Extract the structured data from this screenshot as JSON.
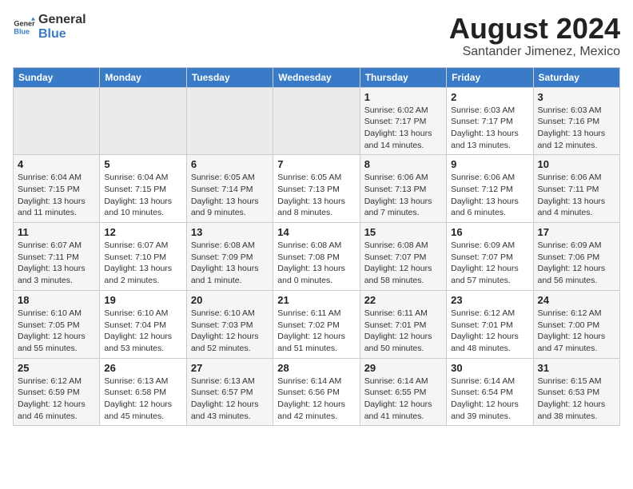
{
  "header": {
    "logo_line1": "General",
    "logo_line2": "Blue",
    "main_title": "August 2024",
    "subtitle": "Santander Jimenez, Mexico"
  },
  "calendar": {
    "days_of_week": [
      "Sunday",
      "Monday",
      "Tuesday",
      "Wednesday",
      "Thursday",
      "Friday",
      "Saturday"
    ],
    "weeks": [
      [
        {
          "day": "",
          "info": ""
        },
        {
          "day": "",
          "info": ""
        },
        {
          "day": "",
          "info": ""
        },
        {
          "day": "",
          "info": ""
        },
        {
          "day": "1",
          "info": "Sunrise: 6:02 AM\nSunset: 7:17 PM\nDaylight: 13 hours\nand 14 minutes."
        },
        {
          "day": "2",
          "info": "Sunrise: 6:03 AM\nSunset: 7:17 PM\nDaylight: 13 hours\nand 13 minutes."
        },
        {
          "day": "3",
          "info": "Sunrise: 6:03 AM\nSunset: 7:16 PM\nDaylight: 13 hours\nand 12 minutes."
        }
      ],
      [
        {
          "day": "4",
          "info": "Sunrise: 6:04 AM\nSunset: 7:15 PM\nDaylight: 13 hours\nand 11 minutes."
        },
        {
          "day": "5",
          "info": "Sunrise: 6:04 AM\nSunset: 7:15 PM\nDaylight: 13 hours\nand 10 minutes."
        },
        {
          "day": "6",
          "info": "Sunrise: 6:05 AM\nSunset: 7:14 PM\nDaylight: 13 hours\nand 9 minutes."
        },
        {
          "day": "7",
          "info": "Sunrise: 6:05 AM\nSunset: 7:13 PM\nDaylight: 13 hours\nand 8 minutes."
        },
        {
          "day": "8",
          "info": "Sunrise: 6:06 AM\nSunset: 7:13 PM\nDaylight: 13 hours\nand 7 minutes."
        },
        {
          "day": "9",
          "info": "Sunrise: 6:06 AM\nSunset: 7:12 PM\nDaylight: 13 hours\nand 6 minutes."
        },
        {
          "day": "10",
          "info": "Sunrise: 6:06 AM\nSunset: 7:11 PM\nDaylight: 13 hours\nand 4 minutes."
        }
      ],
      [
        {
          "day": "11",
          "info": "Sunrise: 6:07 AM\nSunset: 7:11 PM\nDaylight: 13 hours\nand 3 minutes."
        },
        {
          "day": "12",
          "info": "Sunrise: 6:07 AM\nSunset: 7:10 PM\nDaylight: 13 hours\nand 2 minutes."
        },
        {
          "day": "13",
          "info": "Sunrise: 6:08 AM\nSunset: 7:09 PM\nDaylight: 13 hours\nand 1 minute."
        },
        {
          "day": "14",
          "info": "Sunrise: 6:08 AM\nSunset: 7:08 PM\nDaylight: 13 hours\nand 0 minutes."
        },
        {
          "day": "15",
          "info": "Sunrise: 6:08 AM\nSunset: 7:07 PM\nDaylight: 12 hours\nand 58 minutes."
        },
        {
          "day": "16",
          "info": "Sunrise: 6:09 AM\nSunset: 7:07 PM\nDaylight: 12 hours\nand 57 minutes."
        },
        {
          "day": "17",
          "info": "Sunrise: 6:09 AM\nSunset: 7:06 PM\nDaylight: 12 hours\nand 56 minutes."
        }
      ],
      [
        {
          "day": "18",
          "info": "Sunrise: 6:10 AM\nSunset: 7:05 PM\nDaylight: 12 hours\nand 55 minutes."
        },
        {
          "day": "19",
          "info": "Sunrise: 6:10 AM\nSunset: 7:04 PM\nDaylight: 12 hours\nand 53 minutes."
        },
        {
          "day": "20",
          "info": "Sunrise: 6:10 AM\nSunset: 7:03 PM\nDaylight: 12 hours\nand 52 minutes."
        },
        {
          "day": "21",
          "info": "Sunrise: 6:11 AM\nSunset: 7:02 PM\nDaylight: 12 hours\nand 51 minutes."
        },
        {
          "day": "22",
          "info": "Sunrise: 6:11 AM\nSunset: 7:01 PM\nDaylight: 12 hours\nand 50 minutes."
        },
        {
          "day": "23",
          "info": "Sunrise: 6:12 AM\nSunset: 7:01 PM\nDaylight: 12 hours\nand 48 minutes."
        },
        {
          "day": "24",
          "info": "Sunrise: 6:12 AM\nSunset: 7:00 PM\nDaylight: 12 hours\nand 47 minutes."
        }
      ],
      [
        {
          "day": "25",
          "info": "Sunrise: 6:12 AM\nSunset: 6:59 PM\nDaylight: 12 hours\nand 46 minutes."
        },
        {
          "day": "26",
          "info": "Sunrise: 6:13 AM\nSunset: 6:58 PM\nDaylight: 12 hours\nand 45 minutes."
        },
        {
          "day": "27",
          "info": "Sunrise: 6:13 AM\nSunset: 6:57 PM\nDaylight: 12 hours\nand 43 minutes."
        },
        {
          "day": "28",
          "info": "Sunrise: 6:14 AM\nSunset: 6:56 PM\nDaylight: 12 hours\nand 42 minutes."
        },
        {
          "day": "29",
          "info": "Sunrise: 6:14 AM\nSunset: 6:55 PM\nDaylight: 12 hours\nand 41 minutes."
        },
        {
          "day": "30",
          "info": "Sunrise: 6:14 AM\nSunset: 6:54 PM\nDaylight: 12 hours\nand 39 minutes."
        },
        {
          "day": "31",
          "info": "Sunrise: 6:15 AM\nSunset: 6:53 PM\nDaylight: 12 hours\nand 38 minutes."
        }
      ]
    ]
  }
}
